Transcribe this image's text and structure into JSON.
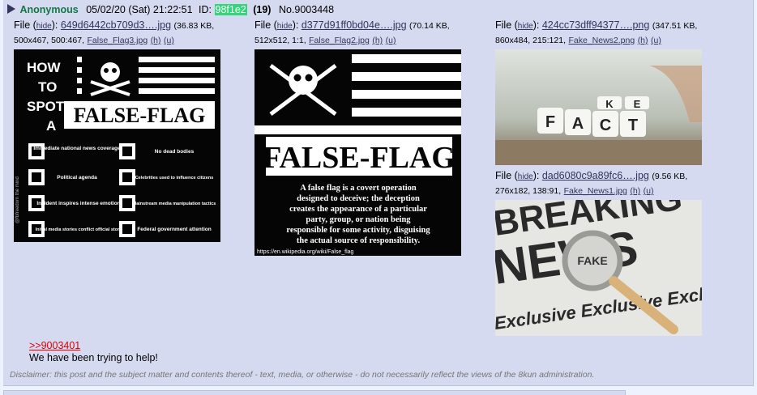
{
  "post": {
    "name": "Anonymous",
    "datetime": "05/02/20 (Sat) 21:22:51",
    "id_label": "ID:",
    "id_value": "98f1e2",
    "id_count": "(19)",
    "number": "No.9003448",
    "quote_link": ">>9003401",
    "message": "We have been trying to help!",
    "disclaimer": "Disclaimer: this post and the subject matter and contents thereof - text, media, or otherwise - do not necessarily reflect the views of the 8kun administration."
  },
  "files": [
    {
      "file_label": "File",
      "hide": "hide",
      "name": "649d6442cb709d3….jpg",
      "size": "(36.83 KB,",
      "dims": "500x467, 500:467,",
      "orig": "False_Flag3.jpg",
      "h": "(h)",
      "u": "(u)",
      "image": {
        "heading": [
          "HOW",
          "TO",
          "SPOT",
          "A"
        ],
        "banner": "FALSE-FLAG",
        "side_text": "@fbfreedom the mind",
        "items": [
          "Immediate national news coverage",
          "No dead bodies",
          "Political agenda",
          "Celebrities used to influence citizens",
          "Incident inspires intense emotion",
          "Mainstream media manipulation tactics",
          "Initial media stories conflict official story",
          "Federal government attention"
        ]
      }
    },
    {
      "file_label": "File",
      "hide": "hide",
      "name": "d377d91ff0bd04e….jpg",
      "size": "(70.14 KB,",
      "dims": "512x512, 1:1,",
      "orig": "False_Flag2.jpg",
      "h": "(h)",
      "u": "(u)",
      "image": {
        "banner": "FALSE-FLAG",
        "lines": [
          "A false flag is a covert operation",
          "designed to deceive; the deception",
          "creates the appearance of a particular",
          "party, group, or nation being",
          "responsible for some activity, disguising",
          "the actual source of responsibility."
        ],
        "url": "https://en.wikipedia.org/wiki/False_flag"
      }
    },
    {
      "file_label": "File",
      "hide": "hide",
      "name": "424cc73dff94377….png",
      "size": "(347.51 KB,",
      "dims": "860x484, 215:121,",
      "orig": "Fake_News2.png",
      "h": "(h)",
      "u": "(u)",
      "image": {
        "cubes_bottom": [
          "F",
          "A",
          "C",
          "T"
        ],
        "cubes_top": [
          "K",
          "E"
        ]
      }
    },
    {
      "file_label": "File",
      "hide": "hide",
      "name": "dad6080c9a89fc6….jpg",
      "size": "(9.56 KB,",
      "dims": "276x182, 138:91,",
      "orig": "Fake_News1.jpg",
      "h": "(h)",
      "u": "(u)",
      "image": {
        "headline": "BREAKING",
        "headline2": "NEWS",
        "magnified": "FAKE",
        "footer": "Exclusive Exclusive Excl"
      }
    }
  ],
  "colors": {
    "post_bg": "#d6daf0",
    "name": "#117743",
    "link": "#34345c",
    "quote": "#dd0000",
    "id_bg": "#31d67a"
  }
}
